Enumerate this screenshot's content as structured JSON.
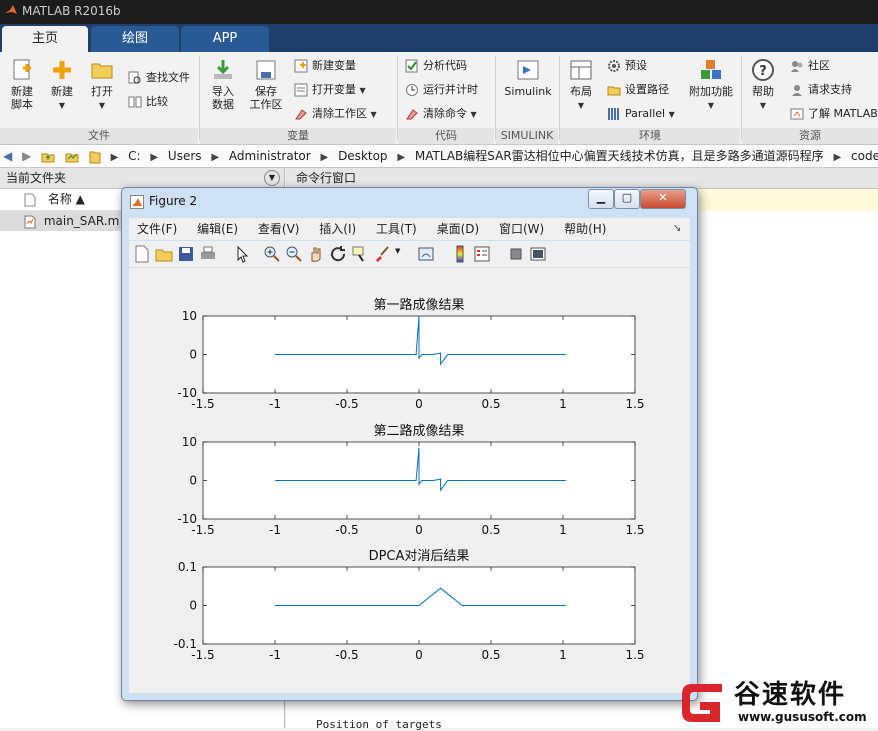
{
  "window": {
    "title": "MATLAB R2016b"
  },
  "tabs": [
    {
      "label": "主页"
    },
    {
      "label": "绘图"
    },
    {
      "label": "APP"
    }
  ],
  "ribbon": {
    "file": {
      "new_script": "新建\n脚本",
      "new": "新建",
      "open": "打开",
      "find_files": "查找文件",
      "compare": "比较",
      "group_label": "文件"
    },
    "variable": {
      "import_data": "导入\n数据",
      "save_workspace": "保存\n工作区",
      "new_variable": "新建变量",
      "open_variable": "打开变量",
      "clear_workspace": "清除工作区",
      "group_label": "变量"
    },
    "code": {
      "analyze_code": "分析代码",
      "run_and_time": "运行并计时",
      "clear_commands": "清除命令",
      "group_label": "代码"
    },
    "simulink": {
      "simulink": "Simulink",
      "group_label": "SIMULINK"
    },
    "environment": {
      "layout": "布局",
      "preferences": "预设",
      "set_path": "设置路径",
      "parallel": "Parallel",
      "addons": "附加功能",
      "group_label": "环境"
    },
    "resources": {
      "help": "帮助",
      "community": "社区",
      "request_support": "请求支持",
      "learn_matlab": "了解 MATLAB",
      "group_label": "资源"
    }
  },
  "address": {
    "crumbs": [
      "C:",
      "Users",
      "Administrator",
      "Desktop",
      "MATLAB编程SAR雷达相位中心偏置天线技术仿真，且是多路多通道源码程序",
      "code"
    ]
  },
  "current_folder": {
    "title": "当前文件夹",
    "col_name": "名称 ▲",
    "files": [
      {
        "name": "main_SAR.m"
      }
    ]
  },
  "command_window": {
    "title": "命令行窗口",
    "output_line": "Position of targets"
  },
  "figure": {
    "title": "Figure 2",
    "menus": [
      "文件(F)",
      "编辑(E)",
      "查看(V)",
      "插入(I)",
      "工具(T)",
      "桌面(D)",
      "窗口(W)",
      "帮助(H)"
    ],
    "toolbar_icons": [
      "new-figure-icon",
      "open-file-icon",
      "save-icon",
      "print-icon",
      "pointer-icon",
      "zoom-in-icon",
      "zoom-out-icon",
      "pan-icon",
      "rotate-icon",
      "data-cursor-icon",
      "brush-icon",
      "link-plot-icon",
      "colorbar-icon",
      "legend-icon",
      "hide-plot-tools-icon",
      "show-plot-tools-icon"
    ]
  },
  "chart_data": [
    {
      "type": "line",
      "title": "第一路成像结果",
      "xlim": [
        -1.5,
        1.5
      ],
      "ylim": [
        -10,
        10
      ],
      "xticks": [
        "-1.5",
        "-1",
        "-0.5",
        "0",
        "0.5",
        "1",
        "1.5"
      ],
      "yticks": [
        "10",
        "0",
        "-10"
      ],
      "color": "#0072bd",
      "series": [
        {
          "x": [
            -1.0,
            -0.02,
            0.0,
            0.0,
            0.02,
            0.1,
            0.15,
            0.15,
            0.2,
            1.02
          ],
          "y": [
            0,
            0,
            10,
            -1,
            0,
            0,
            0.4,
            -2.5,
            0,
            0
          ]
        }
      ]
    },
    {
      "type": "line",
      "title": "第二路成像结果",
      "xlim": [
        -1.5,
        1.5
      ],
      "ylim": [
        -10,
        10
      ],
      "xticks": [
        "-1.5",
        "-1",
        "-0.5",
        "0",
        "0.5",
        "1",
        "1.5"
      ],
      "yticks": [
        "10",
        "0",
        "-10"
      ],
      "color": "#0072bd",
      "series": [
        {
          "x": [
            -1.0,
            -0.02,
            0.0,
            0.0,
            0.02,
            0.1,
            0.15,
            0.15,
            0.2,
            1.02
          ],
          "y": [
            0,
            0,
            8.5,
            -1,
            0,
            0,
            0.4,
            -2.5,
            0,
            0
          ]
        }
      ]
    },
    {
      "type": "line",
      "title": "DPCA对消后结果",
      "xlim": [
        -1.5,
        1.5
      ],
      "ylim": [
        -0.1,
        0.1
      ],
      "xticks": [
        "-1.5",
        "-1",
        "-0.5",
        "0",
        "0.5",
        "1",
        "1.5"
      ],
      "yticks": [
        "0.1",
        "0",
        "-0.1"
      ],
      "color": "#0072bd",
      "series": [
        {
          "x": [
            -1.0,
            0.0,
            0.15,
            0.3,
            1.02
          ],
          "y": [
            0,
            0,
            0.045,
            0,
            0
          ]
        }
      ]
    }
  ],
  "watermark": {
    "brand": "谷速软件",
    "url": "www.gususoft.com"
  }
}
